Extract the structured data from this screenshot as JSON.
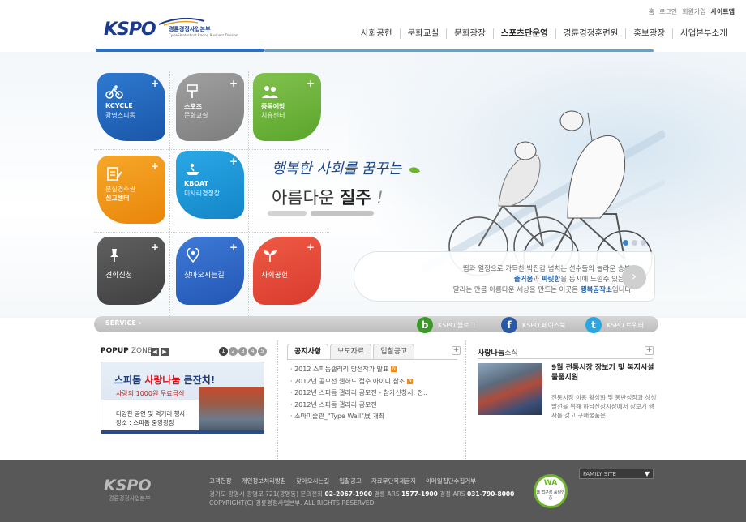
{
  "header": {
    "logo_text": "KSPO",
    "logo_sub": "경륜경정사업본부",
    "logo_sub_en": "Cycle&Motorboat Racing Business Division",
    "util_links": [
      "홈",
      "로그인",
      "회원가입",
      "사이트맵"
    ],
    "nav": [
      "사회공헌",
      "문화교실",
      "문화광장",
      "스포츠단운영",
      "경륜경정훈련원",
      "홍보광장",
      "사업본부소개"
    ],
    "active_nav": "스포츠단운영"
  },
  "tiles": [
    {
      "title": "KCYCLE",
      "sub": "광명스피돔",
      "color": "#1f63b8",
      "icon": "cycle-icon"
    },
    {
      "title": "스포츠",
      "sub": "문화교실",
      "color": "#8b8b8b",
      "icon": "sign-icon"
    },
    {
      "title": "중독예방",
      "sub": "치유센터",
      "color": "#6db33f",
      "icon": "people-icon"
    },
    {
      "title": "분실경주권",
      "sub": "신고센터",
      "color": "#f0920f",
      "icon": "ticket-icon"
    },
    {
      "title": "KBOAT",
      "sub": "미사리경정장",
      "color": "#1f95d6",
      "icon": "boat-icon"
    },
    {
      "title": "",
      "sub": "",
      "color": "#ffffff",
      "icon": ""
    },
    {
      "title": "견학신청",
      "sub": "",
      "color": "#555555",
      "icon": "pin-icon"
    },
    {
      "title": "찾아오시는길",
      "sub": "",
      "color": "#2f66c4",
      "icon": "location-icon"
    },
    {
      "title": "사회공헌",
      "sub": "",
      "color": "#e5463a",
      "icon": "sprout-icon"
    }
  ],
  "visual": {
    "slogan_line1": "행복한 사회를 꿈꾸는",
    "slogan_line2_a": "아름다운",
    "slogan_line2_b": "질주",
    "slogan_mark": "!",
    "quote_l1": "땀과 열정으로 가득찬 박진감 넘치는 선수들의 놀라운 승부!",
    "quote_l2_a": "즐거움",
    "quote_l2_b": "과",
    "quote_l2_c": "짜릿함",
    "quote_l2_d": "을 동시에 느낄수 있는곳!",
    "quote_l3_a": "달리는 만큼 아름다운 세상을 만드는 이곳은",
    "quote_l3_b": "행복공작소",
    "quote_l3_c": "입니다.",
    "next_glyph": "›"
  },
  "service": {
    "label": "SERVICE",
    "arrow": "›",
    "sns": [
      {
        "glyph": "b",
        "label": "KSPO 블로그",
        "color": "#3b9a27"
      },
      {
        "glyph": "f",
        "label": "KSPO 페이스북",
        "color": "#2b5aa5"
      },
      {
        "glyph": "t",
        "label": "KSPO 트위터",
        "color": "#2aa6e0"
      }
    ]
  },
  "popup": {
    "title": "POPUP",
    "title_sub": "ZONE",
    "prev": "◀",
    "next": "▶",
    "pages": [
      "1",
      "2",
      "3",
      "4",
      "5"
    ],
    "banner_h1_a": "스피돔",
    "banner_h1_b": "사랑나눔",
    "banner_h1_c": "큰잔치!",
    "banner_h2": "사랑의 1000원 무료급식",
    "banner_d1": "다양한 공연 및 먹거리 행사",
    "banner_d2": "장소 : 스피돔 중앙광장"
  },
  "notice": {
    "tabs": [
      "공지사항",
      "보도자료",
      "입찰공고"
    ],
    "more": "+",
    "items": [
      {
        "text": "· 2012 스피돔갤러리 당선작가 발표",
        "new": true
      },
      {
        "text": "· 2012년 공모전 웹하드 접수 아이디 참조",
        "new": true
      },
      {
        "text": "· 2012년 스피돔 갤러리 공모전 - 참가신청서, 전..",
        "new": false
      },
      {
        "text": "· 2012년 스피돔 갤러리 공모전",
        "new": false
      },
      {
        "text": "· 소마미술관_\"Type Wall\"展 개최",
        "new": false
      }
    ],
    "new_label": "N"
  },
  "share": {
    "title": "사랑나눔",
    "title_sub": "소식",
    "more": "+",
    "headline": "9월 전통시장 장보기 및 복지시설 물품지원",
    "body": "전통시장 이용 활성화 및 동반성장과 상생발전을 위해 하남신장시장에서 장보기 행사를 갖고 구매물품은.."
  },
  "footer": {
    "logo": "KSPO",
    "logo_sub": "경륜경정사업본부",
    "links": [
      "고객헌장",
      "개인정보처리방침",
      "찾아오시는길",
      "입찰공고",
      "자료무단복제금지",
      "이메일집단수집거부"
    ],
    "addr_a": "경기도 광명시 광명로 721(광명동) 문의전화",
    "tel1": "02-2067-1900",
    "addr_b": "경륜 ARS",
    "tel2": "1577-1900",
    "addr_c": "경정 ARS",
    "tel3": "031-790-8000",
    "copyright": "COPYRIGHT(C) 경륜경정사업본부. ALL RIGHTS RESERVED.",
    "badge_wa": "WA",
    "badge_txt": "웹 접근성 품질인증",
    "family_site": "FAMILY SITE",
    "family_dd": "▼"
  }
}
